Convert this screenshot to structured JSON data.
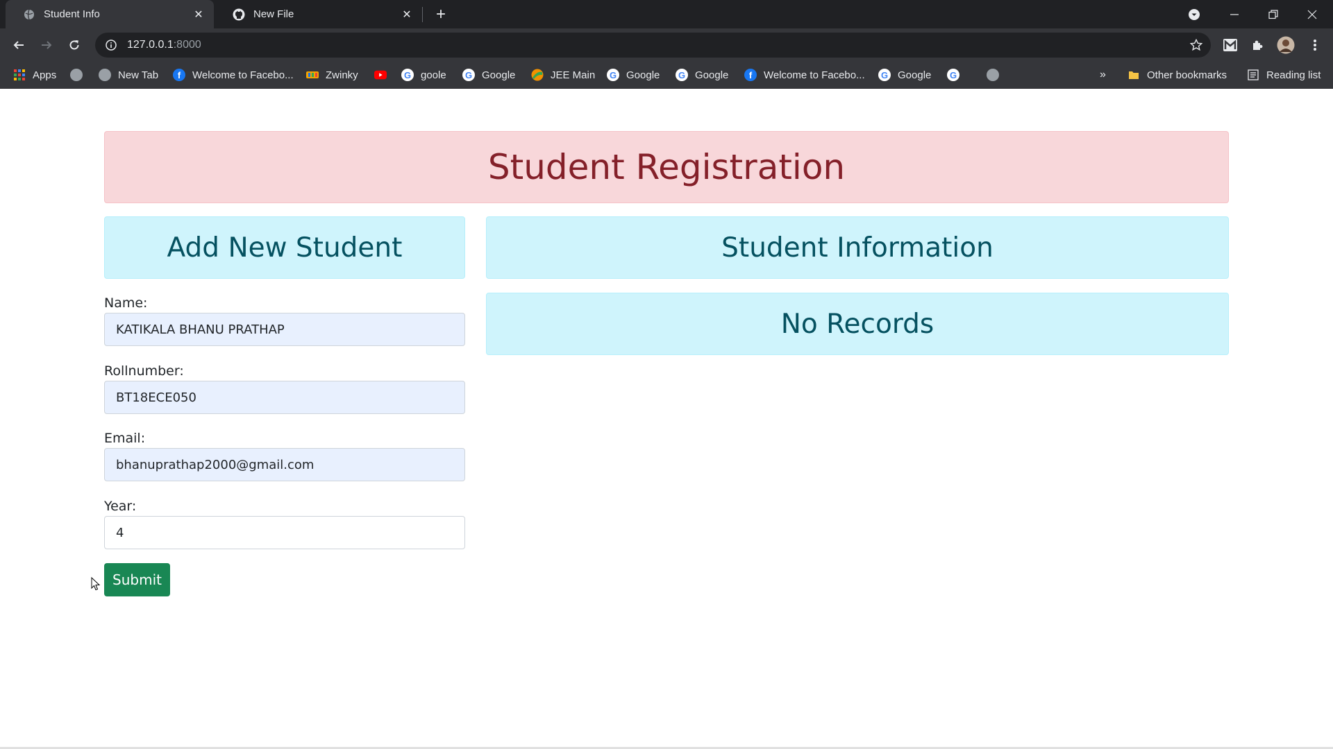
{
  "browser": {
    "tabs": [
      {
        "title": "Student Info",
        "active": true
      },
      {
        "title": "New File",
        "active": false
      }
    ],
    "url": {
      "host": "127.0.0.1",
      "port": ":8000"
    },
    "bookmarks": [
      {
        "label": "Apps",
        "icon": "apps-grid-icon"
      },
      {
        "label": "",
        "icon": "globe-icon"
      },
      {
        "label": "New Tab",
        "icon": "globe-icon"
      },
      {
        "label": "Welcome to Facebo...",
        "icon": "facebook-icon"
      },
      {
        "label": "Zwinky",
        "icon": "zwinky-icon"
      },
      {
        "label": "",
        "icon": "youtube-icon"
      },
      {
        "label": "goole",
        "icon": "google-icon"
      },
      {
        "label": "Google",
        "icon": "google-icon"
      },
      {
        "label": "JEE Main",
        "icon": "jee-icon"
      },
      {
        "label": "Google",
        "icon": "google-icon"
      },
      {
        "label": "Google",
        "icon": "google-icon"
      },
      {
        "label": "Welcome to Facebo...",
        "icon": "facebook-icon"
      },
      {
        "label": "Google",
        "icon": "google-icon"
      },
      {
        "label": "",
        "icon": "google-icon"
      },
      {
        "label": "",
        "icon": "globe-icon"
      }
    ],
    "other_bookmarks": "Other bookmarks",
    "reading_list": "Reading list",
    "overflow": "»"
  },
  "page": {
    "header": "Student Registration",
    "add_panel_title": "Add New Student",
    "info_panel_title": "Student Information",
    "no_records": "No Records",
    "form": {
      "name_label": "Name:",
      "name_value": "KATIKALA BHANU PRATHAP",
      "roll_label": "Rollnumber:",
      "roll_value": "BT18ECE050",
      "email_label": "Email:",
      "email_value": "bhanuprathap2000@gmail.com",
      "year_label": "Year:",
      "year_value": "4",
      "submit_label": "Submit"
    }
  },
  "colors": {
    "danger_bg": "#f8d7da",
    "danger_text": "#842029",
    "info_bg": "#cff4fc",
    "info_text": "#055160",
    "success": "#198754",
    "autofill_bg": "#e8f0fe"
  }
}
